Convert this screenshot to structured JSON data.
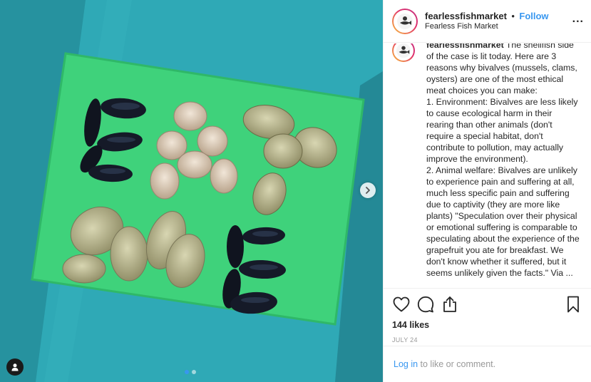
{
  "post": {
    "username": "fearlessfishmarket",
    "bullet": "•",
    "follow_label": "Follow",
    "location": "Fearless Fish Market",
    "more_label": "...",
    "caption_username": "fearlessfishmarket",
    "caption": " The shellfish side of the case is lit today. Here are 3 reasons why bivalves (mussels, clams, oysters) are one of the most ethical meat choices you can make:\n1. Environment: Bivalves are less likely to cause ecological harm in their rearing than other animals (don't require a special habitat, don't contribute to pollution, may actually improve the environment).\n2. Animal welfare: Bivalves are unlikely to experience pain and suffering at all, much less specific pain and suffering due to captivity (they are more like plants) \"Speculation over their physical or emotional suffering is comparable to speculating about the experience of the grapefruit you ate for breakfast. We don't know whether it suffered, but it seems unlikely given the facts.\" Via ...",
    "likes": "144 likes",
    "date": "JULY 24"
  },
  "login": {
    "link": "Log in",
    "rest": " to like or comment."
  },
  "carousel": {
    "slide_count": 2,
    "active_index": 0
  },
  "icons": {
    "like": "heart-icon",
    "comment": "comment-icon",
    "share": "share-icon",
    "save": "bookmark-icon",
    "next": "chevron-right-icon",
    "tag": "user-tag-icon"
  },
  "colors": {
    "accent": "#3897f0",
    "board": "#3ccf7a",
    "background": "#2fa6b3"
  }
}
